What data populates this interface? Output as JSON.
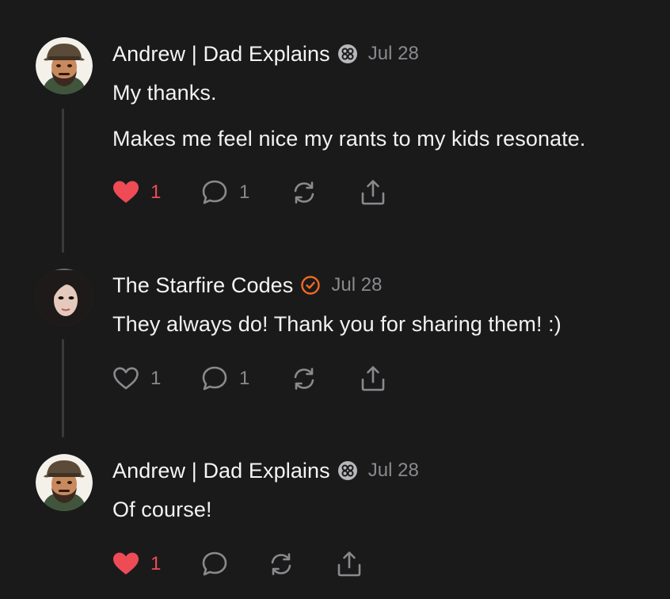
{
  "colors": {
    "background": "#1a1a1b",
    "text": "#f2f2f2",
    "muted": "#8a8a8e",
    "like_active": "#ee4b56",
    "verified_orange": "#f06a23",
    "thread_line": "#3a3a3c"
  },
  "comments": [
    {
      "author": "Andrew | Dad Explains",
      "badge_icon": "subscriber-badge-icon",
      "date": "Jul 28",
      "paragraphs": [
        "My thanks.",
        "Makes me feel nice my rants to my kids resonate."
      ],
      "likes": "1",
      "liked": true,
      "replies": "1"
    },
    {
      "author": "The Starfire Codes",
      "badge_icon": "verified-check-icon",
      "date": "Jul 28",
      "paragraphs": [
        "They always do! Thank you for sharing them! :)"
      ],
      "likes": "1",
      "liked": false,
      "replies": "1"
    },
    {
      "author": "Andrew | Dad Explains",
      "badge_icon": "subscriber-badge-icon",
      "date": "Jul 28",
      "paragraphs": [
        "Of course!"
      ],
      "likes": "1",
      "liked": true,
      "replies": ""
    }
  ]
}
